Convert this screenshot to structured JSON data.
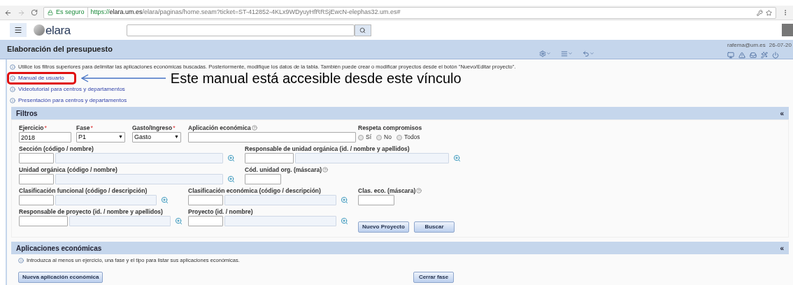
{
  "browser": {
    "secure_label": "Es seguro",
    "url_scheme": "https://",
    "url_host": "elara.um.es",
    "url_path": "/elara/paginas/home.seam?ticket=ST-412852-4KLx9WDyuyHfRRSjEwcN-elephas32.um.es#"
  },
  "app": {
    "logo": "elara"
  },
  "page": {
    "title": "Elaboración del presupuesto",
    "user": "rafema@um.es",
    "date": "26-07-20"
  },
  "info_lines": [
    {
      "kind": "text",
      "text": "Utilice los filtros superiores para delimitar las aplicaciones económicas buscadas. Posteriormente, modifique los datos de la tabla. También puede crear o modificar proyectos desde el botón \"Nuevo/Editar proyecto\".",
      "highlighted": false
    },
    {
      "kind": "link",
      "text": "Manual de usuario",
      "highlighted": true
    },
    {
      "kind": "link",
      "text": "Videotutorial para centros y departamentos",
      "highlighted": false
    },
    {
      "kind": "link",
      "text": "Presentación para centros y departamentos",
      "highlighted": false
    }
  ],
  "annotation": {
    "text": "Este manual está accesible desde este vínculo"
  },
  "filters": {
    "title": "Filtros",
    "collapse": "«",
    "rows": [
      {
        "fields": [
          {
            "kind": "text",
            "label": "Ejercicio",
            "required_mark": "*",
            "value": "2018"
          },
          {
            "kind": "select",
            "label": "Fase",
            "required_mark": "*",
            "value": "P1",
            "arrow": "▼"
          },
          {
            "kind": "select",
            "label": "Gasto/Ingreso",
            "required_mark": "*",
            "value": "Gasto",
            "arrow": "▼"
          },
          {
            "kind": "text",
            "label": "Aplicación económica",
            "help": true
          },
          {
            "kind": "radio",
            "label": "Respeta compromisos",
            "options": [
              {
                "label": "Sí",
                "selected": false
              },
              {
                "label": "No",
                "selected": false
              },
              {
                "label": "Todos",
                "selected": false
              }
            ]
          }
        ]
      },
      {
        "fields": [
          {
            "kind": "lookup",
            "label": "Sección (código / nombre)"
          },
          {
            "kind": "lookup",
            "label": "Responsable de unidad orgánica (id. / nombre y apellidos)"
          }
        ]
      },
      {
        "fields": [
          {
            "kind": "lookup",
            "label": "Unidad orgánica (código / nombre)"
          },
          {
            "kind": "text",
            "label": "Cód. unidad org. (máscara)",
            "help": true
          }
        ]
      },
      {
        "fields": [
          {
            "kind": "lookup",
            "label": "Clasificación funcional (código / descripción)"
          },
          {
            "kind": "lookup",
            "label": "Clasificación económica (código / descripción)"
          },
          {
            "kind": "text",
            "label": "Clas. eco. (máscara)",
            "help": true
          }
        ]
      },
      {
        "fields": [
          {
            "kind": "lookup",
            "label": "Responsable de proyecto (id. / nombre y apellidos)"
          },
          {
            "kind": "lookup",
            "label": "Proyecto (id. / nombre)"
          },
          {
            "kind": "button",
            "label": "Nuevo Proyecto"
          },
          {
            "kind": "button",
            "label": "Buscar"
          }
        ]
      }
    ]
  },
  "applications": {
    "title": "Aplicaciones económicas",
    "collapse": "«",
    "info": "Introduzca al menos un ejercicio, una fase y el tipo para listar sus aplicaciones económicas.",
    "buttons": [
      "Nueva aplicación económica",
      "Cerrar fase"
    ]
  }
}
